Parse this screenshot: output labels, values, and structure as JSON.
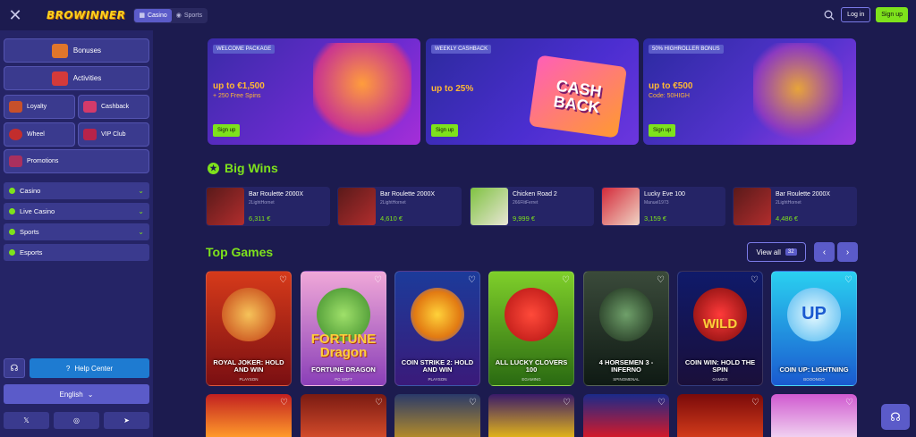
{
  "header": {
    "logo": "BROWINNER",
    "tabs": [
      {
        "label": "Casino"
      },
      {
        "label": "Sports"
      }
    ],
    "login_label": "Log in",
    "signup_label": "Sign up"
  },
  "sidebar": {
    "main_items": [
      {
        "label": "Bonuses"
      },
      {
        "label": "Activities"
      }
    ],
    "grid_items": [
      {
        "label": "Loyalty"
      },
      {
        "label": "Cashback"
      },
      {
        "label": "Wheel"
      },
      {
        "label": "VIP Club"
      },
      {
        "label": "Promotions"
      }
    ],
    "sections": [
      {
        "label": "Casino"
      },
      {
        "label": "Live Casino"
      },
      {
        "label": "Sports"
      },
      {
        "label": "Esports"
      }
    ],
    "help_label": "Help Center",
    "language": "English"
  },
  "banners": [
    {
      "tag": "WELCOME PACKAGE",
      "title": "up to €1,500",
      "sub": "+ 250 Free Spins",
      "cta": "Sign up"
    },
    {
      "tag": "WEEKLY CASHBACK",
      "title": "up to 25%",
      "sub": "",
      "cta": "Sign up",
      "art": "CASH BACK"
    },
    {
      "tag": "50% HIGHROLLER BONUS",
      "title": "up to €500",
      "sub": "Code: 50HIGH",
      "cta": "Sign up"
    }
  ],
  "big_wins": {
    "title": "Big Wins",
    "items": [
      {
        "game": "Bar Roulette 2000X",
        "user": "2LightHornet",
        "amount": "6,311 €"
      },
      {
        "game": "Bar Roulette 2000X",
        "user": "2LightHornet",
        "amount": "4,610 €"
      },
      {
        "game": "Chicken Road 2",
        "user": "266FlitFerret",
        "amount": "9,999 €"
      },
      {
        "game": "Lucky Eve 100",
        "user": "Manuel1973",
        "amount": "3,159 €"
      },
      {
        "game": "Bar Roulette 2000X",
        "user": "2LightHornet",
        "amount": "4,486 €"
      }
    ]
  },
  "top_games": {
    "title": "Top Games",
    "view_all": "View all",
    "count": "32",
    "items": [
      {
        "name": "ROYAL JOKER: HOLD AND WIN",
        "provider": "PLAYSON",
        "art": ""
      },
      {
        "name": "FORTUNE DRAGON",
        "provider": "PG SOFT",
        "art": "FORTUNE Dragon"
      },
      {
        "name": "COIN STRIKE 2: HOLD AND WIN",
        "provider": "PLAYSON",
        "art": ""
      },
      {
        "name": "ALL LUCKY CLOVERS 100",
        "provider": "EGAMING",
        "art": ""
      },
      {
        "name": "4 HORSEMEN 3 - INFERNO",
        "provider": "SPINOMENAL",
        "art": ""
      },
      {
        "name": "COIN WIN: HOLD THE SPIN",
        "provider": "GAMZIX",
        "art": "WILD"
      },
      {
        "name": "COIN UP: LIGHTNING",
        "provider": "BOOONGO",
        "art": "UP"
      }
    ]
  },
  "colors": {
    "bg": "#1c1b4f",
    "sidebar": "#252466",
    "accent_green": "#7ee21c",
    "accent_purple": "#5b5bc9"
  }
}
